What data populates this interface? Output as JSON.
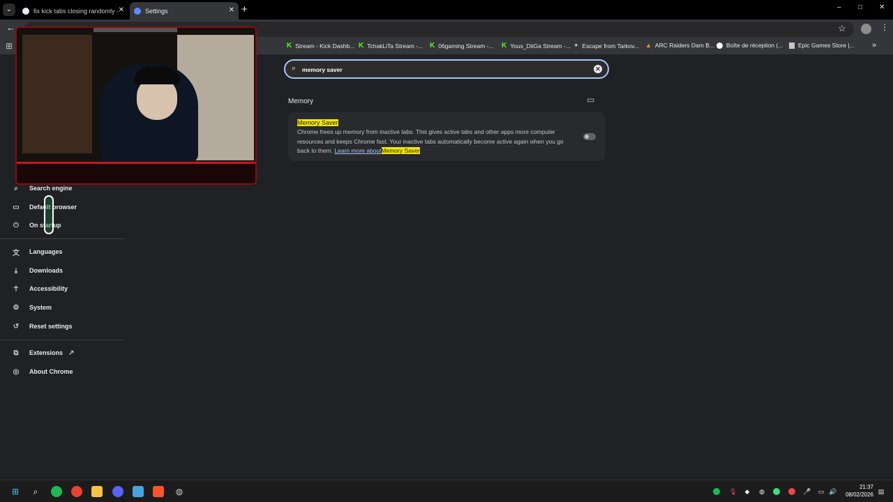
{
  "browser": {
    "tabs": [
      {
        "title": "fix kick tabs closing randomly -",
        "active": false
      },
      {
        "title": "Settings",
        "active": true
      }
    ],
    "new_tab": "+",
    "window_controls": [
      "–",
      "□",
      "✕"
    ]
  },
  "bookmarks": [
    {
      "label": "Stream - Kick Dashb...",
      "icon": "kick-icon"
    },
    {
      "label": "TchakLiTa Stream -...",
      "icon": "kick-icon"
    },
    {
      "label": "06gaming Stream -...",
      "icon": "kick-icon"
    },
    {
      "label": "Yous_DiiGa Stream -...",
      "icon": "kick-icon"
    },
    {
      "label": "Escape from Tarkov...",
      "icon": "tarkov-icon"
    },
    {
      "label": "ARC Raiders Dam B...",
      "icon": "arc-icon"
    },
    {
      "label": "Boîte de réception (...",
      "icon": "google-icon"
    },
    {
      "label": "Epic Games Store |...",
      "icon": "page-icon"
    }
  ],
  "sidebar": {
    "items": [
      {
        "label": "Search engine",
        "icon": "search-icon"
      },
      {
        "label": "Default browser",
        "icon": "browser-icon"
      },
      {
        "label": "On startup",
        "icon": "power-icon"
      },
      {
        "label": "Languages",
        "icon": "translate-icon"
      },
      {
        "label": "Downloads",
        "icon": "download-icon"
      },
      {
        "label": "Accessibility",
        "icon": "accessibility-icon"
      },
      {
        "label": "System",
        "icon": "wrench-icon"
      },
      {
        "label": "Reset settings",
        "icon": "reset-icon"
      },
      {
        "label": "Extensions",
        "icon": "extensions-icon"
      },
      {
        "label": "About Chrome",
        "icon": "chrome-icon"
      }
    ]
  },
  "settings": {
    "search_value": "memory saver",
    "section_title": "Memory",
    "card": {
      "title": "Memory Saver",
      "description": "Chrome frees up memory from inactive tabs. This gives active tabs and other apps more computer resources and keeps Chrome fast. Your inactive tabs automatically become active again when you go back to them.",
      "link_text": "Learn more about",
      "link_highlight": "Memory Saver",
      "toggle_on": false
    }
  },
  "taskbar": {
    "time": "21:37",
    "date": "08/02/2026"
  }
}
